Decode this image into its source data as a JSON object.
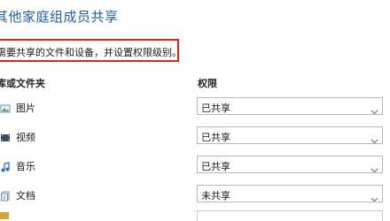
{
  "title": "其他家庭组成员共享",
  "instruction": "需要共享的文件和设备，并设置权限级别。",
  "headers": {
    "library": "库或文件夹",
    "permission": "权限"
  },
  "rows": [
    {
      "label": "图片",
      "icon": "pictures-icon",
      "permission": "已共享"
    },
    {
      "label": "视频",
      "icon": "videos-icon",
      "permission": "已共享"
    },
    {
      "label": "音乐",
      "icon": "music-icon",
      "permission": "已共享"
    },
    {
      "label": "文档",
      "icon": "documents-icon",
      "permission": "未共享"
    }
  ],
  "colors": {
    "title": "#1f5fa8",
    "highlight": "#e2231a"
  }
}
